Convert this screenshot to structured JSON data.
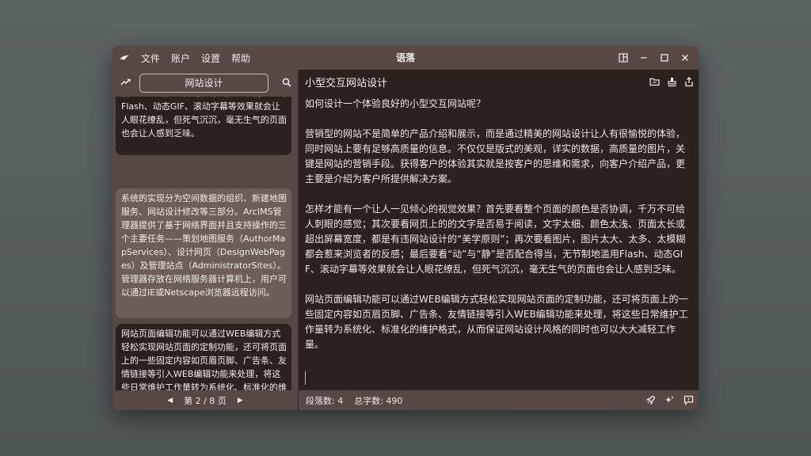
{
  "menu": {
    "file": "文件",
    "account": "账户",
    "settings": "设置",
    "help": "帮助"
  },
  "app_title": "语落",
  "search": {
    "value": "网站设计"
  },
  "cards": [
    "多、太模糊都会惹来浏览者的反感；最后要看“动”与“静”是否配合得当，无节制地滥用Flash、动态GIF、滚动字幕等效果就会让人眼花缭乱，但死气沉沉，毫无生气的页面也会让人感到乏味。",
    "系统的实现分为空间数据的组织、新建地图服务、网站设计修改等三部分。ArcIMS管理器提供了基于网络界面并且支持操作的三个主要任务——策划地图服务（AuthorMapServices）、设计网页（DesignWebPages）及管理站点（AdministratorSites）。管理器存放在网络服务器计算机上，用户可以通过IE或Netscape浏览器远程访问。",
    "网站页面编辑功能可以通过WEB编辑方式轻松实现网站页面的定制功能，还可将页面上的一些固定内容如页眉页脚、广告条、友情链接等引入WEB编辑功能来处理，将这些日常维护工作量转为系统化、标准化的维护格式，从而保证网站设计风格的同时也可以大大减轻工作量。"
  ],
  "pager": {
    "label": "第 2 / 8 页"
  },
  "document": {
    "title": "小型交互网站设计",
    "paragraphs": [
      "如何设计一个体验良好的小型交互网站呢？",
      "营销型的网站不是简单的产品介绍和展示，而是通过精美的网站设计让人有很愉悦的体验，同时网站上要有足够高质量的信息。不仅仅是版式的美观，详实的数据，高质量的图片，关键是网站的营销手段。获得客户的体验其实就是按客户的思维和需求，向客户介绍产品，更主要是介绍为客户所提供解决方案。",
      "怎样才能有一个让人一见倾心的视觉效果？首先要看整个页面的颜色是否协调，千万不可给人刺眼的感觉；其次要看网页上的的文字是否易于阅读，文字太细、颜色太浅、页面太长或超出屏幕宽度，都是有违网站设计的“美学原则”；再次要看图片，图片太大、太多、太模糊都会惹来浏览者的反感；最后要看“动”与“静”是否配合得当，无节制地滥用Flash、动态GIF、滚动字幕等效果就会让人眼花缭乱，但死气沉沉，毫无生气的页面也会让人感到乏味。",
      "网站页面编辑功能可以通过WEB编辑方式轻松实现网站页面的定制功能，还可将页面上的一些固定内容如页眉页脚、广告条、友情链接等引入WEB编辑功能来处理，将这些日常维护工作量转为系统化、标准化的维护格式，从而保证网站设计风格的同时也可以大大减轻工作量。"
    ]
  },
  "status": {
    "paragraphs": "段落数: 4",
    "chars": "总字数: 490"
  },
  "colors": {
    "window_bg": "#2b2220",
    "chrome": "#574845",
    "active_card": "#6e5e5a",
    "cursor": "#e0a79a"
  },
  "icons": [
    "app-logo-icon",
    "layout-icon",
    "minimize-icon",
    "maximize-icon",
    "close-icon",
    "trend-icon",
    "search-icon",
    "folder-icon",
    "stamp-icon",
    "share-icon",
    "rocket-icon",
    "sparkle-icon",
    "comment-icon",
    "chevron-left-icon",
    "chevron-right-icon"
  ]
}
